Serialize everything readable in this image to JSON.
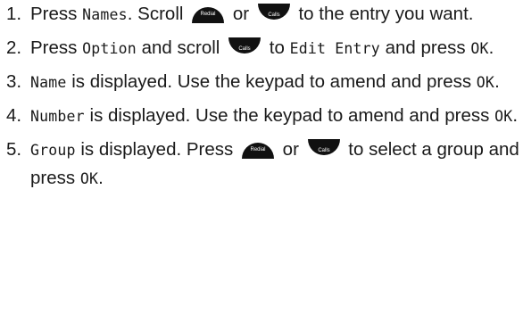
{
  "colors": {
    "text": "#1a1a1a",
    "key_fill": "#111111",
    "key_label": "#ffffff"
  },
  "icons": {
    "up": "redial-up-key",
    "down": "calls-down-key"
  },
  "key_labels": {
    "redial": "Redial",
    "calls": "Calls"
  },
  "steps": [
    {
      "number": "1.",
      "parts": {
        "a": "Press ",
        "lcd_names": "Names",
        "b": ". Scroll ",
        "or": " or ",
        "c": " to the entry you want."
      }
    },
    {
      "number": "2.",
      "parts": {
        "a": "Press ",
        "lcd_option": "Option",
        "b": " and scroll ",
        "c": " to ",
        "lcd_edit": "Edit Entry",
        "d": " and press ",
        "lcd_ok": "OK",
        "e": "."
      }
    },
    {
      "number": "3.",
      "parts": {
        "lcd_name": "Name",
        "a": " is displayed. Use the keypad to amend and press ",
        "lcd_ok": "OK",
        "b": "."
      }
    },
    {
      "number": "4.",
      "parts": {
        "lcd_number": "Number",
        "a": " is displayed. Use the keypad to amend and press ",
        "lcd_ok": "OK",
        "b": "."
      }
    },
    {
      "number": "5.",
      "parts": {
        "lcd_group": "Group",
        "a": " is displayed. Press ",
        "or": " or ",
        "b": " to select a group and press ",
        "lcd_ok": "OK",
        "c": "."
      }
    }
  ]
}
